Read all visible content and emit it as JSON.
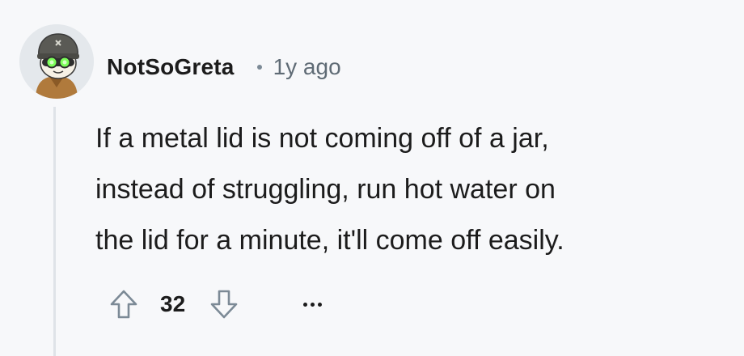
{
  "comment": {
    "username": "NotSoGreta",
    "separator": "•",
    "timestamp": "1y ago",
    "body": "If a metal lid is not coming off of a jar,\ninstead of struggling, run hot water on\nthe lid for a minute, it'll come off easily.",
    "score": "32",
    "icons": {
      "avatar": "snoo-avatar-with-goggles",
      "upvote": "arrow-up-outline-icon",
      "downvote": "arrow-down-outline-icon",
      "more": "ellipsis-horizontal-icon"
    }
  },
  "colors": {
    "background": "#f7f8fa",
    "text": "#1c1c1c",
    "meta": "#5f6b75",
    "thread_line": "#dfe3e8",
    "vote_icon": "#7c8a96"
  }
}
